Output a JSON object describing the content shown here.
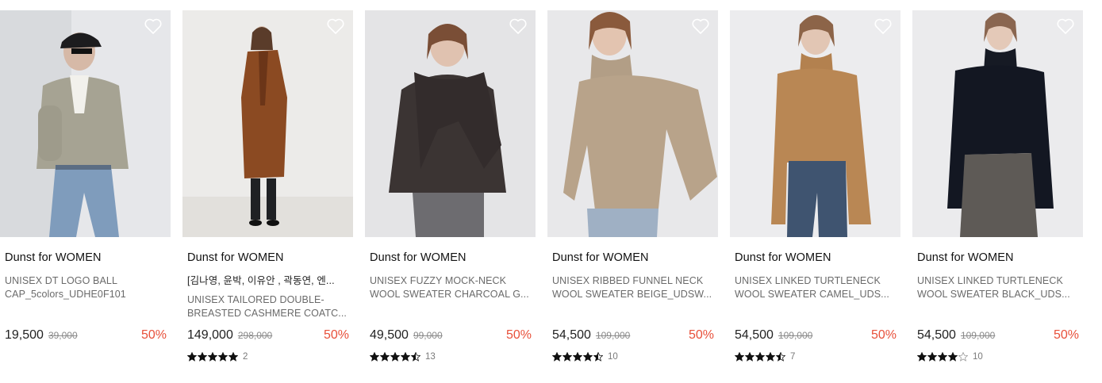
{
  "colors": {
    "discount": "#e8503a",
    "star": "#111111",
    "background": "#ffffff"
  },
  "products": [
    {
      "brand": "Dunst for WOMEN",
      "tag": "",
      "name": "UNISEX DT LOGO BALL CAP_5colors_UDHE0F101",
      "price": "19,500",
      "original_price": "39,000",
      "discount": "50%",
      "rating": null,
      "review_count": "",
      "image_icon": "model-cap-jacket-photo"
    },
    {
      "brand": "Dunst for WOMEN",
      "tag": "[김나영, 윤박, 이유안 , 곽동연, 엔...",
      "name": "UNISEX TAILORED DOUBLE-BREASTED CASHMERE COATC...",
      "price": "149,000",
      "original_price": "298,000",
      "discount": "50%",
      "rating": 5,
      "review_count": "2",
      "image_icon": "model-brown-coat-photo"
    },
    {
      "brand": "Dunst for WOMEN",
      "tag": "",
      "name": "UNISEX FUZZY MOCK-NECK WOOL SWEATER CHARCOAL G...",
      "price": "49,500",
      "original_price": "99,000",
      "discount": "50%",
      "rating": 4.5,
      "review_count": "13",
      "image_icon": "model-charcoal-sweater-photo"
    },
    {
      "brand": "Dunst for WOMEN",
      "tag": "",
      "name": "UNISEX RIBBED FUNNEL NECK WOOL SWEATER BEIGE_UDSW...",
      "price": "54,500",
      "original_price": "109,000",
      "discount": "50%",
      "rating": 4.5,
      "review_count": "10",
      "image_icon": "model-beige-sweater-photo"
    },
    {
      "brand": "Dunst for WOMEN",
      "tag": "",
      "name": "UNISEX LINKED TURTLENECK WOOL SWEATER CAMEL_UDS...",
      "price": "54,500",
      "original_price": "109,000",
      "discount": "50%",
      "rating": 4.5,
      "review_count": "7",
      "image_icon": "model-camel-turtleneck-photo"
    },
    {
      "brand": "Dunst for WOMEN",
      "tag": "",
      "name": "UNISEX LINKED TURTLENECK WOOL SWEATER BLACK_UDS...",
      "price": "54,500",
      "original_price": "109,000",
      "discount": "50%",
      "rating": 4,
      "review_count": "10",
      "image_icon": "model-black-turtleneck-photo"
    }
  ]
}
